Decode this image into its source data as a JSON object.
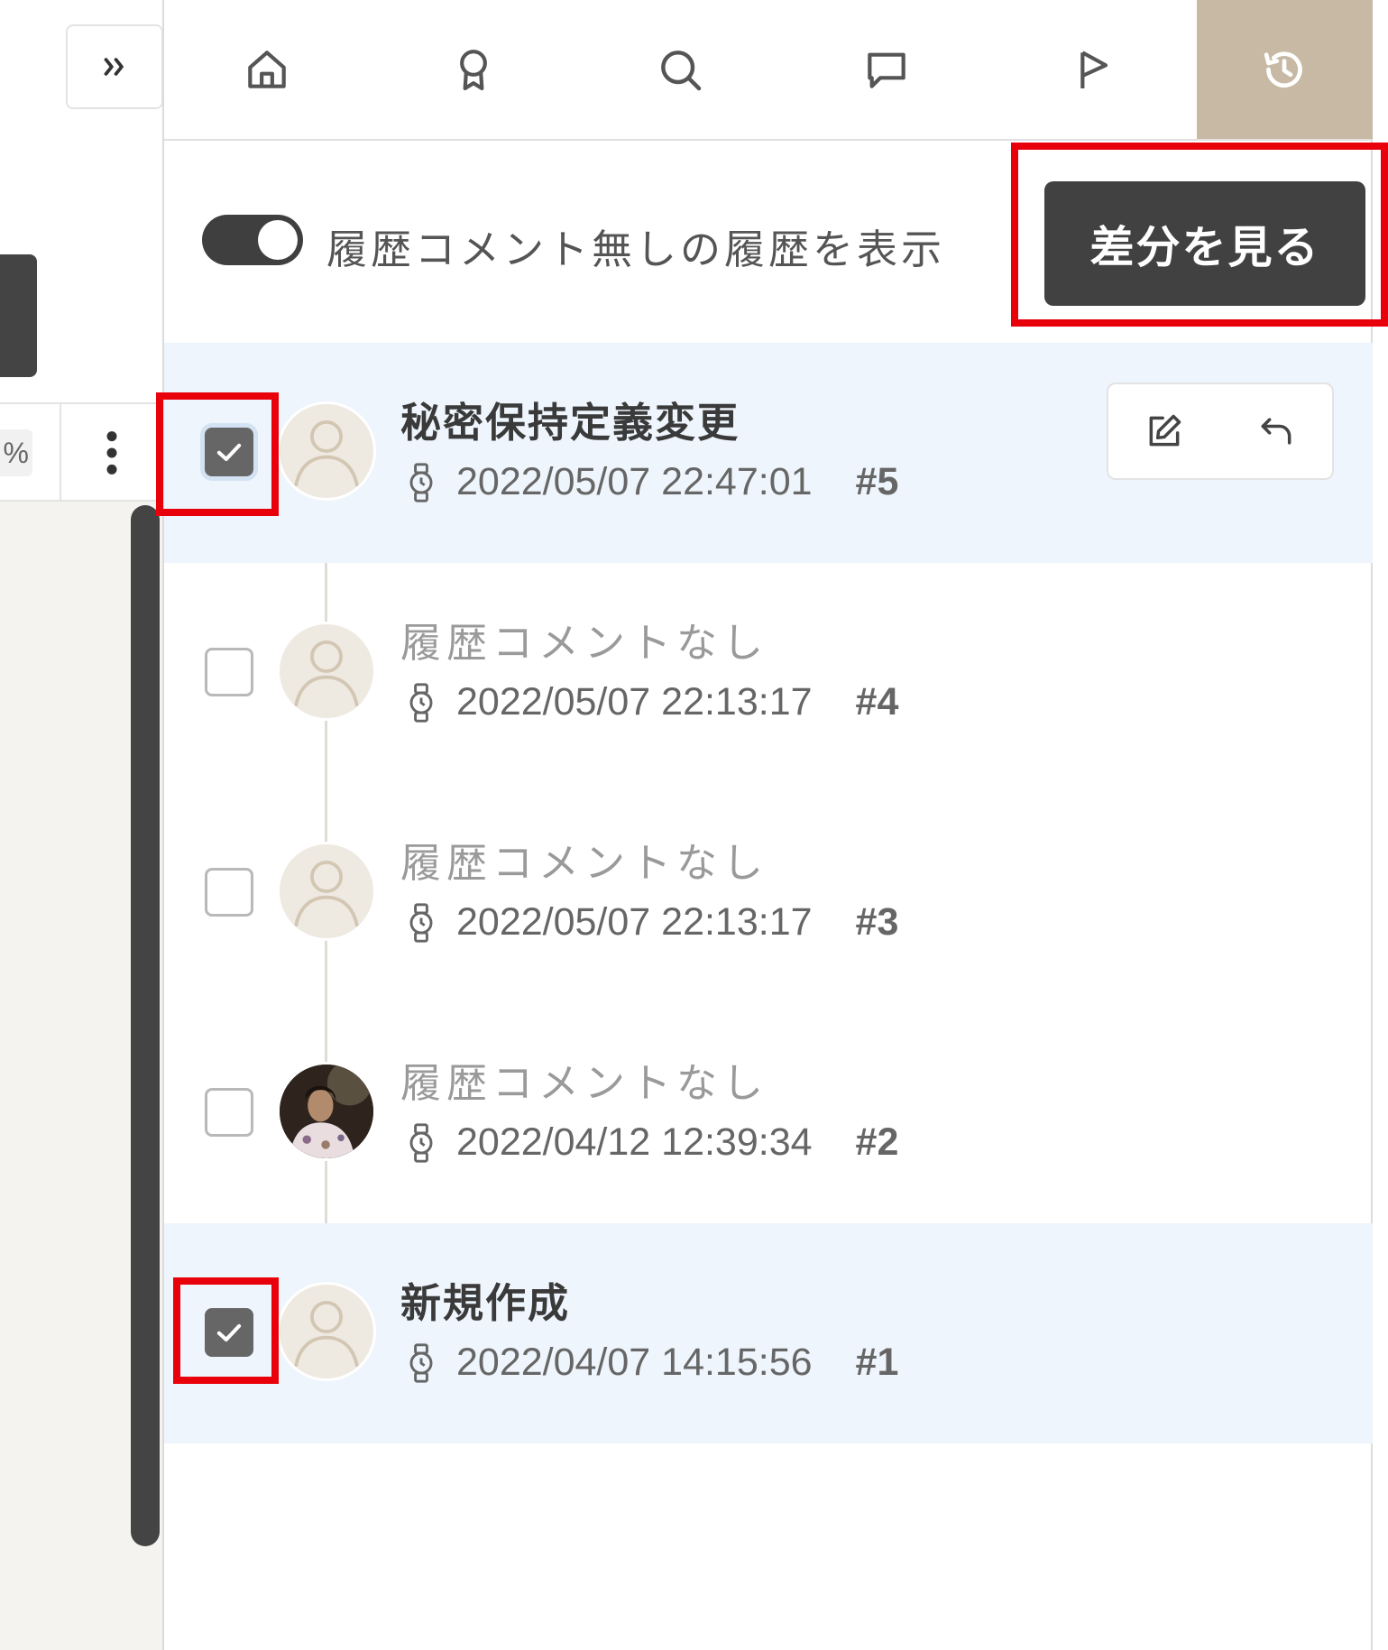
{
  "left": {
    "expand_icon": "double-chevron-right-icon",
    "percent_text": "%",
    "more_icon": "vertical-ellipsis-icon"
  },
  "tabs": [
    {
      "name": "home",
      "icon": "home-icon"
    },
    {
      "name": "award",
      "icon": "award-icon"
    },
    {
      "name": "search",
      "icon": "search-icon"
    },
    {
      "name": "comment",
      "icon": "comment-icon"
    },
    {
      "name": "flag",
      "icon": "flag-icon"
    },
    {
      "name": "history",
      "icon": "history-icon",
      "active": true
    }
  ],
  "controls": {
    "toggle_label": "履歴コメント無しの履歴を表示",
    "toggle_on": true,
    "diff_button": "差分を見る"
  },
  "history": [
    {
      "title": "秘密保持定義変更",
      "timestamp": "2022/05/07 22:47:01",
      "rev": "#5",
      "checked": true,
      "has_comment": true
    },
    {
      "title": "履歴コメントなし",
      "timestamp": "2022/05/07 22:13:17",
      "rev": "#4",
      "checked": false,
      "has_comment": false
    },
    {
      "title": "履歴コメントなし",
      "timestamp": "2022/05/07 22:13:17",
      "rev": "#3",
      "checked": false,
      "has_comment": false
    },
    {
      "title": "履歴コメントなし",
      "timestamp": "2022/04/12 12:39:34",
      "rev": "#2",
      "checked": false,
      "has_comment": false
    },
    {
      "title": "新規作成",
      "timestamp": "2022/04/07 14:15:56",
      "rev": "#1",
      "checked": true,
      "has_comment": true
    }
  ],
  "colors": {
    "active_tab": "#c7b9a4",
    "button_dark": "#414141",
    "selected_row": "#eef5fc",
    "annotation": "#e8000b"
  }
}
